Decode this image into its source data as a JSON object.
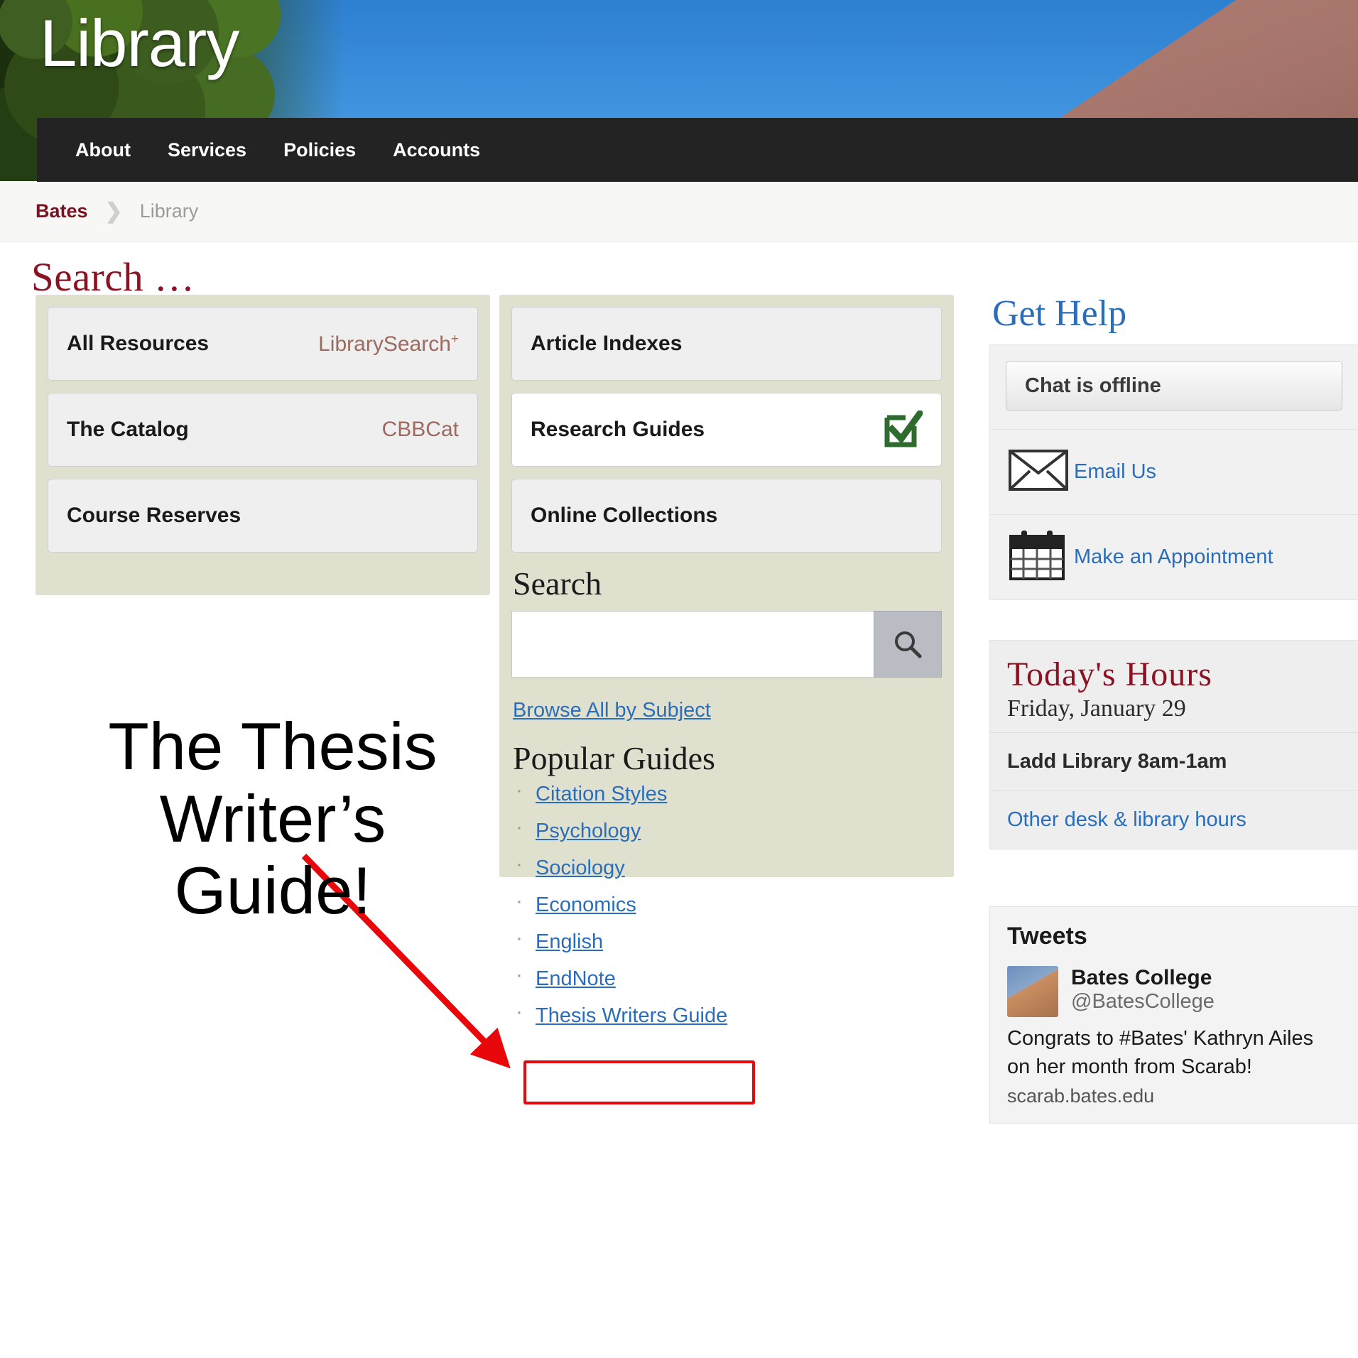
{
  "hero": {
    "title": "Library"
  },
  "nav": {
    "items": [
      "About",
      "Services",
      "Policies",
      "Accounts"
    ]
  },
  "breadcrumb": {
    "root": "Bates",
    "separator": "❯",
    "current": "Library"
  },
  "main": {
    "heading": "Search …",
    "left_tiles": [
      {
        "label": "All Resources",
        "sub": "LibrarySearch",
        "sup": "+"
      },
      {
        "label": "The Catalog",
        "sub": "CBBCat",
        "sup": ""
      },
      {
        "label": "Course Reserves",
        "sub": "",
        "sup": ""
      }
    ],
    "mid_tiles": [
      {
        "label": "Article Indexes",
        "icon": "",
        "active": false
      },
      {
        "label": "Research Guides",
        "icon": "checked-box-icon",
        "active": true
      },
      {
        "label": "Online Collections",
        "icon": "",
        "active": false
      }
    ],
    "search": {
      "title": "Search",
      "value": "",
      "placeholder": "",
      "button_icon": "search-icon"
    },
    "browse_link": "Browse All by Subject",
    "popular_title": "Popular Guides",
    "popular_guides": [
      "Citation Styles",
      "Psychology",
      "Sociology",
      "Economics",
      "English",
      "EndNote",
      "Thesis Writers Guide"
    ]
  },
  "sidebar": {
    "get_help_title": "Get Help",
    "chat_status": "Chat is offline",
    "help_rows": [
      {
        "icon": "envelope-icon",
        "label": "Email Us"
      },
      {
        "icon": "calendar-icon",
        "label": "Make an Appointment"
      }
    ],
    "hours": {
      "title": "Today's Hours",
      "date": "Friday, January 29",
      "row": "Ladd Library 8am-1am",
      "link": "Other desk & library hours"
    },
    "tweets": {
      "title": "Tweets",
      "name": "Bates College",
      "handle": "@BatesCollege",
      "body": "Congrats to #Bates' Kathryn Ailes on her month from Scarab!",
      "url": "scarab.bates.edu"
    }
  },
  "annotation": {
    "line1": "The Thesis",
    "line2": "Writer’s Guide!",
    "arrow_color": "#e8070a",
    "box_color": "#e8070a"
  },
  "colors": {
    "brand_maroon": "#8a1223",
    "link_blue": "#2a6ebb",
    "panel_beige": "#e0e0cf",
    "nav_dark": "#232323",
    "check_green": "#2f6b2f"
  }
}
